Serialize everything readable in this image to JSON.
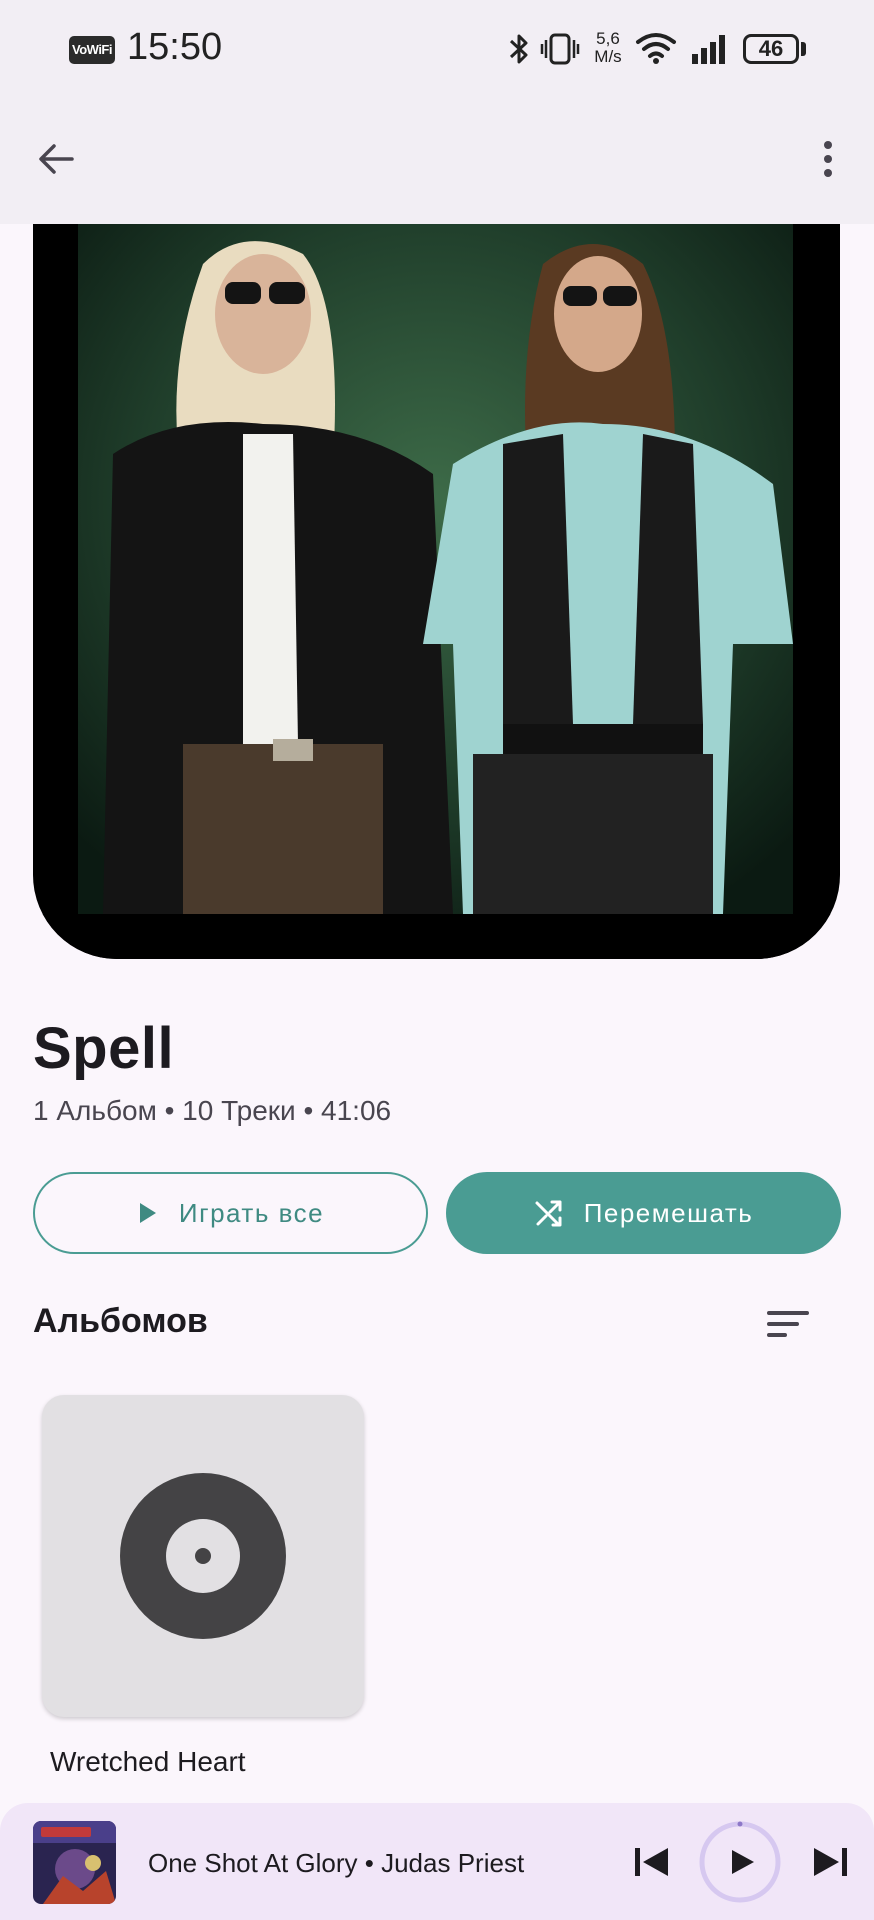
{
  "status_bar": {
    "network_badge": "VoWiFi",
    "time": "15:50",
    "net_speed_value": "5,6",
    "net_speed_unit": "M/s",
    "battery": "46",
    "icons": [
      "bluetooth-icon",
      "vibrate-icon",
      "wifi-icon",
      "signal-icon",
      "battery-icon"
    ]
  },
  "app_bar": {
    "icons": [
      "back-arrow-icon",
      "more-vert-icon"
    ]
  },
  "artist": {
    "name": "Spell",
    "meta": "1 Альбом • 10 Треки • 41:06"
  },
  "actions": {
    "play_all_label": "Играть все",
    "shuffle_label": "Перемешать",
    "accent_color": "#4a9c93"
  },
  "albums_section": {
    "title": "Альбомов",
    "albums": [
      {
        "title": "Wretched Heart",
        "icon": "vinyl-disc-icon"
      }
    ]
  },
  "mini_player": {
    "track_line": "One Shot At Glory • Judas Priest",
    "controls": [
      "skip-previous-icon",
      "play-icon",
      "skip-next-icon"
    ]
  }
}
